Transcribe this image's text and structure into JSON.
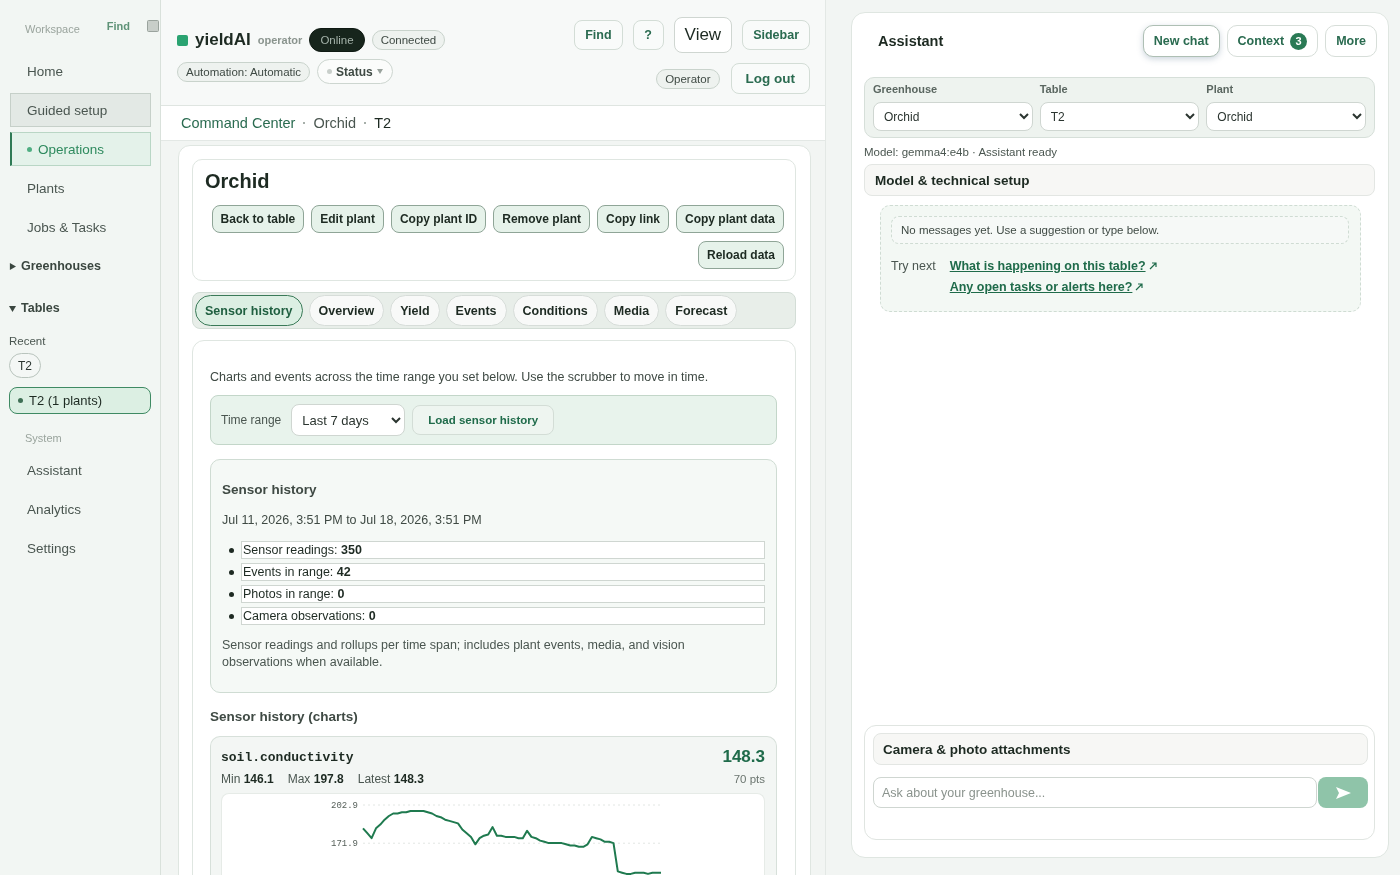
{
  "sidebar": {
    "heading": "Workspace",
    "find": "Find",
    "nav": [
      {
        "label": "Home",
        "selected": false,
        "highlighted": false
      },
      {
        "label": "Guided setup",
        "selected": false,
        "highlighted": true
      },
      {
        "label": "Operations",
        "selected": true,
        "highlighted": false
      },
      {
        "label": "Plants",
        "selected": false,
        "highlighted": false
      },
      {
        "label": "Jobs & Tasks",
        "selected": false,
        "highlighted": false
      }
    ],
    "sections": [
      {
        "label": "Greenhouses",
        "expanded": false
      },
      {
        "label": "Tables",
        "expanded": true,
        "recent_label": "Recent",
        "recent": [
          "T2"
        ],
        "items": [
          {
            "label": "T2 (1 plants)",
            "selected": true
          }
        ]
      }
    ],
    "system_heading": "System",
    "system_nav": [
      {
        "label": "Assistant",
        "selected": false,
        "highlighted": false
      },
      {
        "label": "Analytics",
        "selected": false,
        "highlighted": false
      },
      {
        "label": "Settings",
        "selected": false,
        "highlighted": false
      }
    ]
  },
  "header": {
    "brand": "yieldAI",
    "role": "operator",
    "badges": [
      {
        "label": "Online",
        "kind": "dark"
      },
      {
        "label": "Connected",
        "kind": "light"
      }
    ],
    "automation": "Automation: Automatic",
    "status_menu": "Status",
    "actions": [
      {
        "label": "Find",
        "kind": "accent"
      },
      {
        "label": "?",
        "kind": "accent"
      },
      {
        "label": "View",
        "kind": "plain"
      },
      {
        "label": "Sidebar",
        "kind": "accent"
      }
    ],
    "role_badge": "Operator",
    "logout": "Log out"
  },
  "breadcrumb": [
    {
      "label": "Command Center",
      "kind": "link"
    },
    {
      "label": "Orchid",
      "kind": "text"
    },
    {
      "label": "T2",
      "kind": "current"
    }
  ],
  "plant": {
    "title": "Orchid",
    "actions": [
      "Back to table",
      "Edit plant",
      "Copy plant ID",
      "Remove plant",
      "Copy link",
      "Copy plant data",
      "Reload data"
    ]
  },
  "tabs": [
    {
      "label": "Sensor history",
      "selected": true
    },
    {
      "label": "Overview",
      "selected": false
    },
    {
      "label": "Yield",
      "selected": false
    },
    {
      "label": "Events",
      "selected": false
    },
    {
      "label": "Conditions",
      "selected": false
    },
    {
      "label": "Media",
      "selected": false
    },
    {
      "label": "Forecast",
      "selected": false
    }
  ],
  "sensor_history": {
    "intro": "Charts and events across the time range you set below. Use the scrubber to move in time.",
    "time_range": {
      "label": "Time range",
      "value": "Last 7 days",
      "button": "Load sensor history"
    },
    "summary": {
      "title": "Sensor history",
      "range": "Jul 11, 2026, 3:51 PM to Jul 18, 2026, 3:51 PM",
      "stats": [
        "Sensor readings: **350**",
        "Events in range: **42**",
        "Photos in range: **0**",
        "Camera observations: **0**"
      ],
      "note": "Sensor readings and rollups per time span; includes plant events, media, and vision observations when available."
    },
    "charts_title": "Sensor history (charts)",
    "charts": [
      {
        "metric": "soil.conductivity",
        "latest_value": "148.3",
        "stats": [
          "Min **146.1**",
          "Max **197.8**",
          "Latest **148.3**"
        ],
        "points": "70 pts",
        "chart_data": {
          "type": "line",
          "ylim": [
            146.1,
            202.9
          ],
          "yticks": [
            202.9,
            171.9
          ],
          "values": [
            184,
            180,
            176,
            184,
            187,
            191,
            194,
            196,
            196,
            197,
            197,
            198,
            198,
            198,
            198,
            197,
            196,
            194,
            193,
            191,
            190,
            189,
            188,
            183,
            180,
            177,
            171,
            176,
            178,
            179,
            185,
            178,
            178,
            177,
            177,
            177,
            176,
            176,
            182,
            177,
            176,
            174,
            173,
            172,
            172,
            172,
            172,
            171,
            170,
            170,
            169,
            169,
            171,
            177,
            176,
            175,
            173,
            173,
            172,
            149,
            148,
            147,
            147,
            148,
            148,
            148,
            147,
            148,
            148,
            148
          ]
        }
      }
    ]
  },
  "assistant": {
    "title": "Assistant",
    "actions": [
      {
        "label": "New chat",
        "focused": true
      },
      {
        "label": "Context",
        "focused": false,
        "count": "3"
      },
      {
        "label": "More",
        "focused": false
      }
    ],
    "context": [
      {
        "label": "Greenhouse",
        "value": "Orchid"
      },
      {
        "label": "Table",
        "value": "T2"
      },
      {
        "label": "Plant",
        "value": "Orchid"
      }
    ],
    "status": "Model: gemma4:e4b · Assistant ready",
    "setup_title": "Model & technical setup",
    "empty_message": "No messages yet. Use a suggestion or type below.",
    "suggestions_label": "Try next",
    "suggestions": [
      "What is happening on this table?",
      "Any open tasks or alerts here?"
    ],
    "attachments_title": "Camera & photo attachments",
    "input": {
      "placeholder": "Ask about your greenhouse..."
    }
  }
}
